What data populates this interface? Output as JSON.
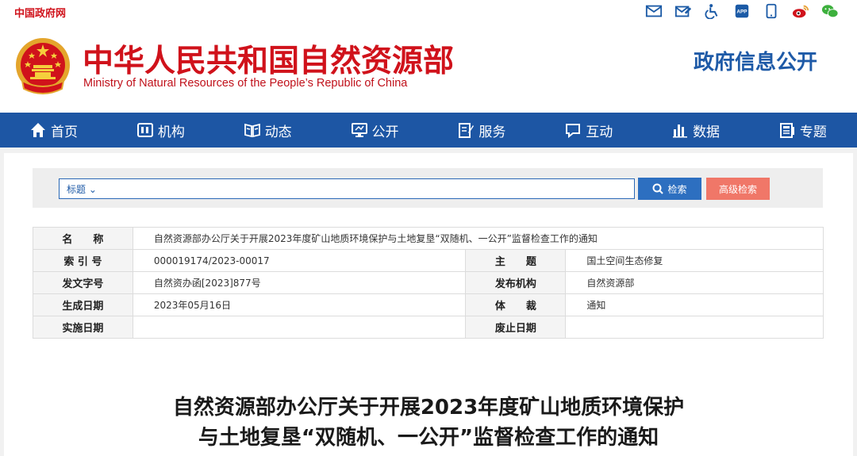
{
  "topbar": {
    "gov_link": "中国政府网",
    "icons": [
      "mail-icon",
      "mail-edit-icon",
      "accessibility-icon",
      "app-icon",
      "mobile-icon",
      "weibo-icon",
      "wechat-icon"
    ],
    "app_label": "APP"
  },
  "header": {
    "cn_title": "中华人民共和国自然资源部",
    "en_title": "Ministry of Natural Resources of the People’s Republic of China",
    "gov_info": "政府信息公开"
  },
  "nav": {
    "items": [
      {
        "label": "首页",
        "icon": "home-icon"
      },
      {
        "label": "机构",
        "icon": "org-icon"
      },
      {
        "label": "动态",
        "icon": "book-icon"
      },
      {
        "label": "公开",
        "icon": "monitor-icon"
      },
      {
        "label": "服务",
        "icon": "edit-doc-icon"
      },
      {
        "label": "互动",
        "icon": "chat-icon"
      },
      {
        "label": "数据",
        "icon": "bar-chart-icon"
      },
      {
        "label": "专题",
        "icon": "doc-list-icon"
      }
    ]
  },
  "search": {
    "select_label": "标题",
    "placeholder": "",
    "search_button": "检索",
    "advanced_button": "高级检索"
  },
  "meta": {
    "name_label": "名　　称",
    "name_value": "自然资源部办公厅关于开展2023年度矿山地质环境保护与土地复垦“双随机、一公开”监督检查工作的通知",
    "index_label": "索 引 号",
    "index_value": "000019174/2023-00017",
    "subject_label": "主　　题",
    "subject_value": "国土空间生态修复",
    "docno_label": "发文字号",
    "docno_value": "自然资办函[2023]877号",
    "issuer_label": "发布机构",
    "issuer_value": "自然资源部",
    "date_label": "生成日期",
    "date_value": "2023年05月16日",
    "genre_label": "体　　裁",
    "genre_value": "通知",
    "impl_label": "实施日期",
    "impl_value": "",
    "expire_label": "废止日期",
    "expire_value": ""
  },
  "article": {
    "title_line1": "自然资源部办公厅关于开展2023年度矿山地质环境保护",
    "title_line2": "与土地复垦“双随机、一公开”监督检查工作的通知"
  },
  "colors": {
    "brand_red": "#d0121b",
    "brand_blue": "#1d56a4",
    "search_blue": "#2d6fc0",
    "advanced_salmon": "#f07768"
  }
}
